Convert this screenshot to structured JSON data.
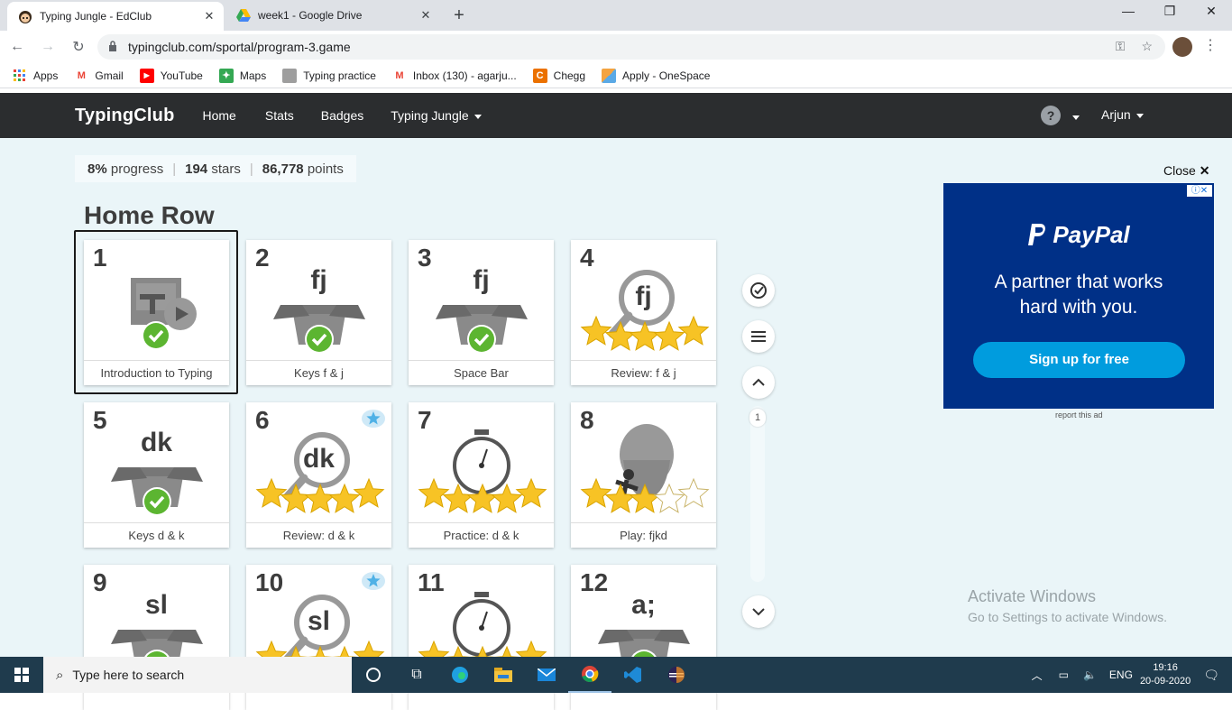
{
  "browser": {
    "tabs": [
      {
        "title": "Typing Jungle - EdClub",
        "active": true
      },
      {
        "title": "week1 - Google Drive",
        "active": false
      }
    ],
    "new_tab": "+",
    "url": "typingclub.com/sportal/program-3.game",
    "bookmarks": [
      {
        "label": "Apps",
        "icon": "apps-grid-icon"
      },
      {
        "label": "Gmail",
        "icon": "gmail-icon"
      },
      {
        "label": "YouTube",
        "icon": "youtube-icon"
      },
      {
        "label": "Maps",
        "icon": "maps-icon"
      },
      {
        "label": "Typing practice",
        "icon": "typing-practice-icon"
      },
      {
        "label": "Inbox (130) - agarju...",
        "icon": "gmail-icon"
      },
      {
        "label": "Chegg",
        "icon": "chegg-icon"
      },
      {
        "label": "Apply - OneSpace",
        "icon": "onespace-icon"
      }
    ]
  },
  "site": {
    "logo": "TypingClub",
    "nav": [
      "Home",
      "Stats",
      "Badges",
      "Typing Jungle"
    ],
    "help": "?",
    "user": "Arjun"
  },
  "stats": {
    "progress_value": "8%",
    "progress_label": "progress",
    "stars_value": "194",
    "stars_label": "stars",
    "points_value": "86,778",
    "points_label": "points"
  },
  "section_title": "Home Row",
  "lessons": [
    {
      "num": "1",
      "glyph": "",
      "label": "Introduction to Typing",
      "type": "video",
      "stars": 0
    },
    {
      "num": "2",
      "glyph": "fj",
      "label": "Keys f & j",
      "type": "box",
      "stars": 0
    },
    {
      "num": "3",
      "glyph": "fj",
      "label": "Space Bar",
      "type": "box",
      "stars": 0
    },
    {
      "num": "4",
      "glyph": "fj",
      "label": "Review: f & j",
      "type": "review",
      "stars": 5
    },
    {
      "num": "5",
      "glyph": "dk",
      "label": "Keys d & k",
      "type": "box",
      "stars": 0
    },
    {
      "num": "6",
      "glyph": "dk",
      "label": "Review: d & k",
      "type": "review",
      "stars": 5,
      "badge": true
    },
    {
      "num": "7",
      "glyph": "",
      "label": "Practice: d & k",
      "type": "timer",
      "stars": 5
    },
    {
      "num": "8",
      "glyph": "",
      "label": "Play: fjkd",
      "type": "game",
      "stars": 3
    },
    {
      "num": "9",
      "glyph": "sl",
      "label": "",
      "type": "box",
      "stars": 0
    },
    {
      "num": "10",
      "glyph": "sl",
      "label": "",
      "type": "review",
      "stars": 5,
      "badge": true
    },
    {
      "num": "11",
      "glyph": "",
      "label": "",
      "type": "timer",
      "stars": 5
    },
    {
      "num": "12",
      "glyph": "a;",
      "label": "",
      "type": "box",
      "stars": 0
    }
  ],
  "side": {
    "page": "1"
  },
  "ad": {
    "close_label": "Close",
    "close_icon": "✕",
    "adchoices": "ⓘ✕",
    "brand": "PayPal",
    "tagline_line1": "A partner that works",
    "tagline_line2": "hard with you.",
    "cta": "Sign up for free",
    "report": "report this ad"
  },
  "watermark": {
    "line1": "Activate Windows",
    "line2": "Go to Settings to activate Windows."
  },
  "taskbar": {
    "search_placeholder": "Type here to search",
    "lang": "ENG",
    "time": "19:16",
    "date": "20-09-2020"
  },
  "colors": {
    "nav_bg": "#2b2d2f",
    "main_bg": "#eaf5f8",
    "star": "#f7c325",
    "check": "#5cb531",
    "ad_bg": "#003087",
    "ad_cta": "#009cde"
  }
}
